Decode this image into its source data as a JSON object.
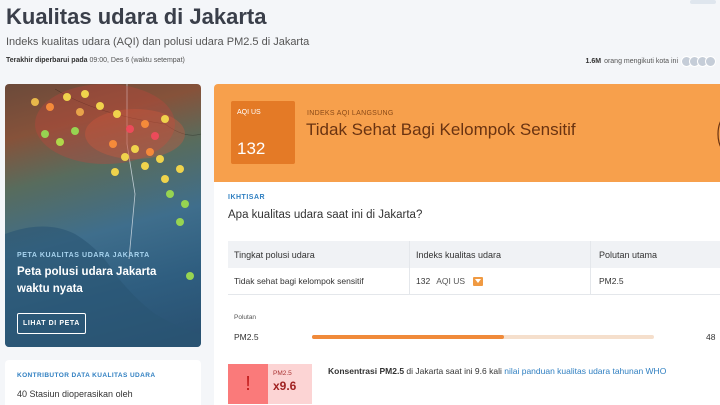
{
  "header": {
    "title": "Kualitas udara di Jakarta",
    "subtitle": "Indeks kualitas udara (AQI) dan polusi udara PM2.5 di Jakarta",
    "updated_prefix": "Terakhir diperbarui pada",
    "updated_value": "09:00, Des 6 (waktu setempat)",
    "followers_count": "1.6M",
    "followers_text": "orang mengikuti kota ini"
  },
  "map_card": {
    "kicker": "PETA KUALITAS UDARA JAKARTA",
    "title": "Peta polusi udara Jakarta waktu nyata",
    "button": "LIHAT DI PETA"
  },
  "contributors": {
    "kicker": "KONTRIBUTOR DATA KUALITAS UDARA",
    "text": "40 Stasiun dioperasikan oleh"
  },
  "banner": {
    "aqi_label": "AQI US",
    "aqi_value": "132",
    "live_label": "INDEKS AQI LANGSUNG",
    "status": "Tidak Sehat Bagi Kelompok Sensitif",
    "color": "#f7a04c",
    "box_color": "#e47a26"
  },
  "overview": {
    "kicker": "IKHTISAR",
    "question": "Apa kualitas udara saat ini di Jakarta?",
    "table": {
      "headers": [
        "Tingkat polusi udara",
        "Indeks kualitas udara",
        "Polutan utama"
      ],
      "row": {
        "level": "Tidak sehat bagi kelompok sensitif",
        "aqi": "132",
        "aqi_unit": "AQI US",
        "pollutant": "PM2.5"
      }
    }
  },
  "pollutants": {
    "label": "Polutan",
    "items": [
      {
        "name": "PM2.5",
        "value": "48",
        "fill_fraction": 0.56
      }
    ]
  },
  "concentration": {
    "badge_label": "PM2.5",
    "multiplier": "x9.6",
    "prefix": "Konsentrasi PM2.5",
    "middle": " di Jakarta saat ini 9.6 kali ",
    "link": "nilai panduan kualitas udara tahunan WHO"
  }
}
